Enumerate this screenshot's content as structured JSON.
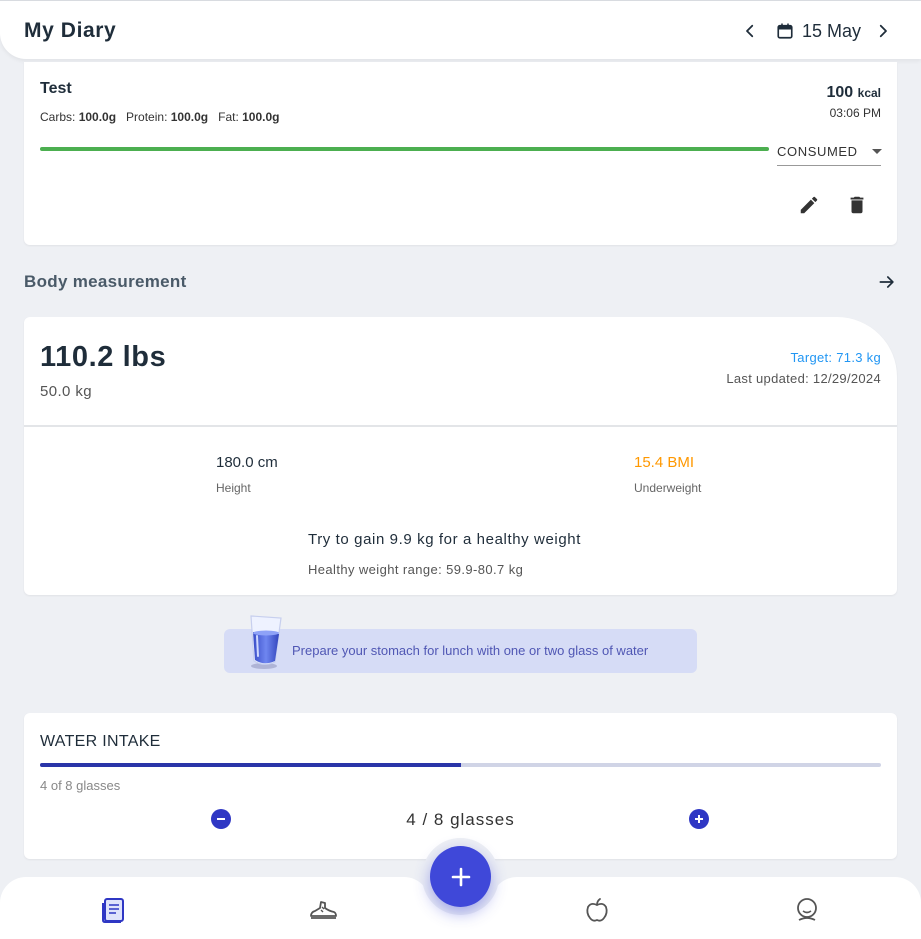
{
  "header": {
    "title": "My Diary",
    "date": "15 May"
  },
  "food_entry": {
    "name": "Test",
    "macros": [
      {
        "label": "Carbs:",
        "value": "100.0g"
      },
      {
        "label": "Protein:",
        "value": "100.0g"
      },
      {
        "label": "Fat:",
        "value": "100.0g"
      }
    ],
    "kcal_value": "100",
    "kcal_unit": "kcal",
    "time": "03:06 PM",
    "status": "CONSUMED"
  },
  "body_measurement": {
    "section_title": "Body measurement",
    "weight_lbs": "110.2 lbs",
    "weight_kg": "50.0 kg",
    "target": "Target: 71.3 kg",
    "last_updated": "Last updated: 12/29/2024",
    "height_value": "180.0 cm",
    "height_label": "Height",
    "bmi_value": "15.4 BMI",
    "bmi_label": "Underweight",
    "advice": "Try to gain 9.9 kg for a healthy weight",
    "healthy_range": "Healthy weight range: 59.9-80.7 kg"
  },
  "tip": {
    "text": "Prepare your stomach for lunch with one or two glass of water"
  },
  "water_intake": {
    "title": "WATER INTAKE",
    "subtitle": "4 of 8 glasses",
    "count_text": "4 / 8 glasses",
    "progress": 0.5
  },
  "colors": {
    "accent": "#3f48d9",
    "success": "#4caf50",
    "target": "#2196f3",
    "warning": "#ff9800"
  },
  "icons": {
    "nav": [
      "diary-icon",
      "activity-icon",
      "nutrition-icon",
      "profile-icon"
    ],
    "fab": "plus-icon"
  }
}
